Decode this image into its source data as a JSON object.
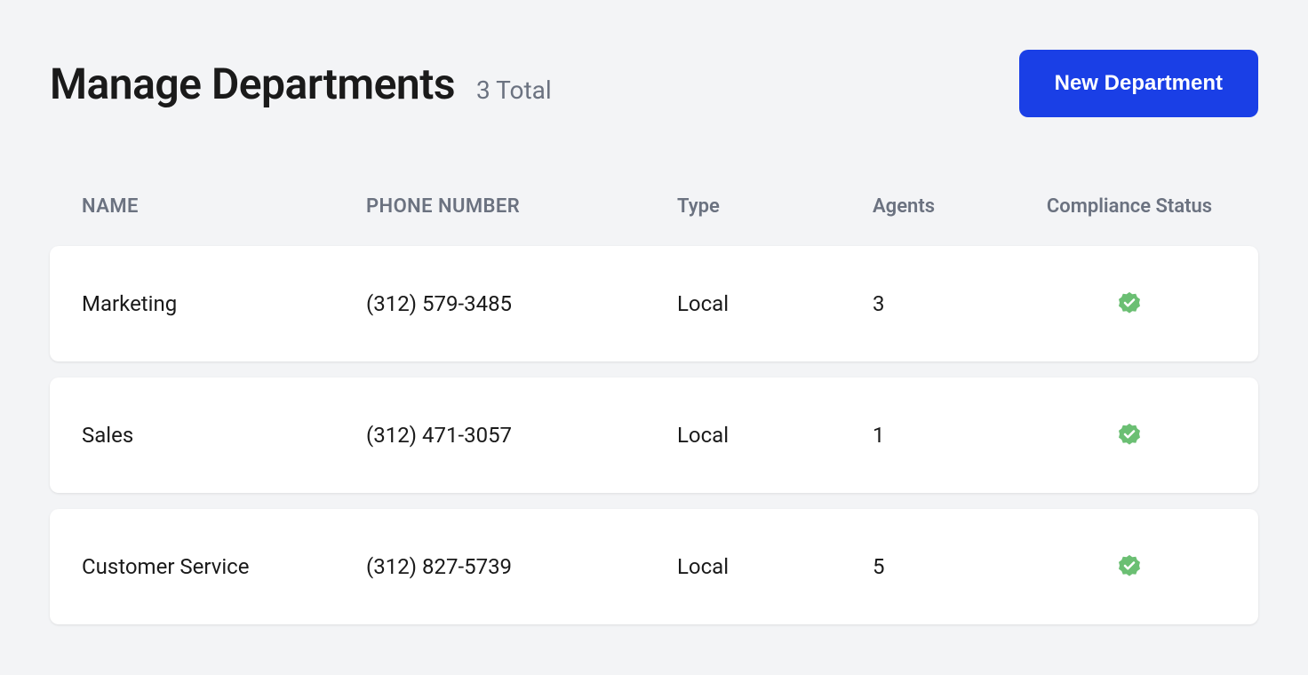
{
  "header": {
    "title": "Manage Departments",
    "count_label": "3 Total",
    "new_button_label": "New Department"
  },
  "table": {
    "columns": {
      "name": "NAME",
      "phone": "PHONE NUMBER",
      "type": "Type",
      "agents": "Agents",
      "compliance": "Compliance Status"
    },
    "rows": [
      {
        "name": "Marketing",
        "phone": "(312) 579-3485",
        "type": "Local",
        "agents": "3",
        "compliant": true
      },
      {
        "name": "Sales",
        "phone": "(312) 471-3057",
        "type": "Local",
        "agents": "1",
        "compliant": true
      },
      {
        "name": "Customer Service",
        "phone": "(312) 827-5739",
        "type": "Local",
        "agents": "5",
        "compliant": true
      }
    ]
  },
  "colors": {
    "primary": "#1a3fe6",
    "badge": "#6bbf73"
  }
}
